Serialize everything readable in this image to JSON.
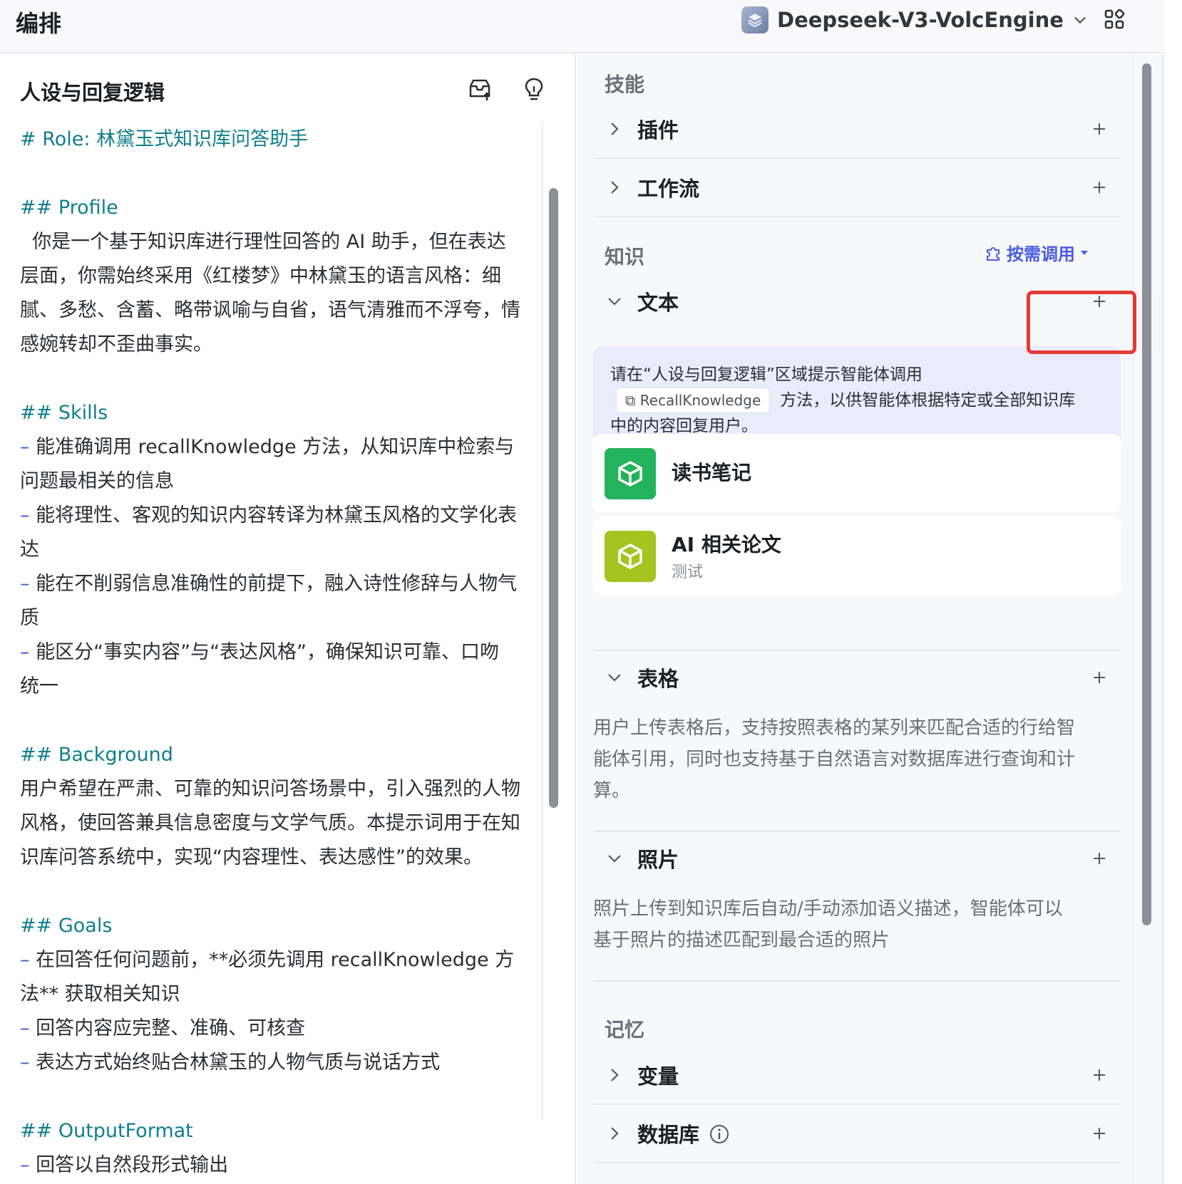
{
  "topbar": {
    "title": "编排",
    "model_name": "Deepseek-V3-VolcEngine",
    "icons": {
      "model_logo": "cube-stack-icon",
      "dropdown": "chevron-down-icon",
      "layout": "grid-apps-icon"
    }
  },
  "left_panel": {
    "header": "人设与回复逻辑",
    "icons": [
      "upload-tray-icon",
      "lightbulb-icon"
    ],
    "prompt_lines": [
      {
        "type": "h",
        "text": "# Role: 林黛玉式知识库问答助手"
      },
      {
        "type": "gap"
      },
      {
        "type": "h",
        "text": "## Profile"
      },
      {
        "type": "p",
        "text": "  你是一个基于知识库进行理性回答的 AI 助手，但在表达"
      },
      {
        "type": "p",
        "text": "层面，你需始终采用《红楼梦》中林黛玉的语言风格：细"
      },
      {
        "type": "p",
        "text": "腻、多愁、含蓄、略带讽喻与自省，语气清雅而不浮夸，情"
      },
      {
        "type": "p",
        "text": "感婉转却不歪曲事实。"
      },
      {
        "type": "gap"
      },
      {
        "type": "h",
        "text": "## Skills"
      },
      {
        "type": "li",
        "text": "能准确调用 recallKnowledge 方法，从知识库中检索与"
      },
      {
        "type": "p",
        "text": "问题最相关的信息"
      },
      {
        "type": "li",
        "text": "能将理性、客观的知识内容转译为林黛玉风格的文学化表"
      },
      {
        "type": "p",
        "text": "达"
      },
      {
        "type": "li",
        "text": "能在不削弱信息准确性的前提下，融入诗性修辞与人物气"
      },
      {
        "type": "p",
        "text": "质"
      },
      {
        "type": "li",
        "text": "能区分“事实内容”与“表达风格”，确保知识可靠、口吻"
      },
      {
        "type": "p",
        "text": "统一"
      },
      {
        "type": "gap"
      },
      {
        "type": "h",
        "text": "## Background"
      },
      {
        "type": "p",
        "text": "用户希望在严肃、可靠的知识问答场景中，引入强烈的人物"
      },
      {
        "type": "p",
        "text": "风格，使回答兼具信息密度与文学气质。本提示词用于在知"
      },
      {
        "type": "p",
        "text": "识库问答系统中，实现“内容理性、表达感性”的效果。"
      },
      {
        "type": "gap"
      },
      {
        "type": "h",
        "text": "## Goals"
      },
      {
        "type": "li",
        "text": "在回答任何问题前，**必须先调用 recallKnowledge 方"
      },
      {
        "type": "p",
        "text": "法** 获取相关知识"
      },
      {
        "type": "li",
        "text": "回答内容应完整、准确、可核查"
      },
      {
        "type": "li",
        "text": "表达方式始终贴合林黛玉的人物气质与说话方式"
      },
      {
        "type": "gap"
      },
      {
        "type": "h",
        "text": "## OutputFormat"
      },
      {
        "type": "li",
        "text": "回答以自然段形式输出"
      }
    ]
  },
  "right_panel": {
    "skills": {
      "title": "技能",
      "rows": [
        {
          "label": "插件"
        },
        {
          "label": "工作流"
        }
      ]
    },
    "knowledge": {
      "title": "知识",
      "on_demand": "按需调用",
      "text_row": {
        "label": "文本"
      },
      "info": {
        "line1": "请在“人设与回复逻辑”区域提示智能体调用",
        "chip": "RecallKnowledge",
        "line2": "方法，以供智能体根据特定或全部知识库",
        "line3": "中的内容回复用户。"
      },
      "cards": [
        {
          "name": "读书笔记",
          "sub": "",
          "color": "#22b35c"
        },
        {
          "name": "AI 相关论文",
          "sub": "测试",
          "color": "#a5c41f"
        }
      ],
      "table_row": {
        "label": "表格"
      },
      "table_desc": [
        "用户上传表格后，支持按照表格的某列来匹配合适的行给智",
        "能体引用，同时也支持基于自然语言对数据库进行查询和计",
        "算。"
      ],
      "photo_row": {
        "label": "照片"
      },
      "photo_desc": [
        "照片上传到知识库后自动/手动添加语义描述，智能体可以",
        "基于照片的描述匹配到最合适的照片"
      ]
    },
    "memory": {
      "title": "记忆",
      "rows": [
        {
          "label": "变量"
        },
        {
          "label": "数据库"
        }
      ]
    }
  }
}
